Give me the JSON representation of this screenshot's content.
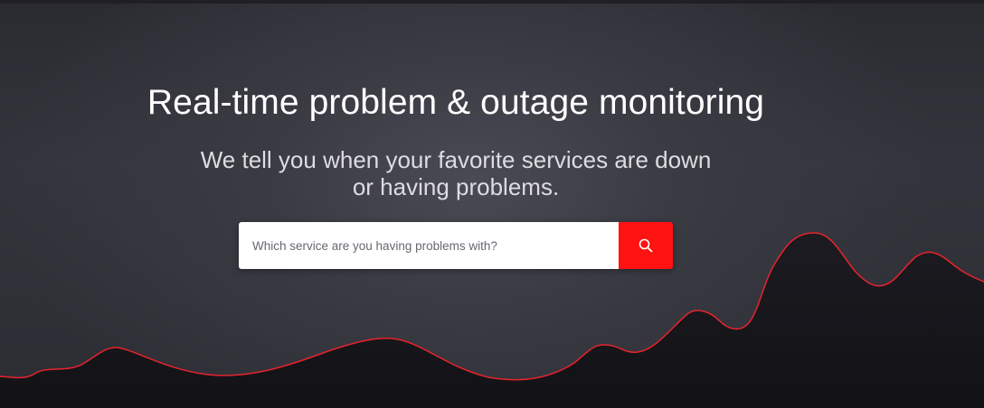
{
  "hero": {
    "title": "Real-time problem & outage monitoring",
    "subtitle_line1": "We tell you when your favorite services are down",
    "subtitle_line2": "or having problems."
  },
  "search": {
    "placeholder": "Which service are you having problems with?",
    "button_icon": "search-icon"
  },
  "colors": {
    "accent": "#ff1212",
    "graph_line": "#e8232b",
    "graph_fill": "#17171c",
    "background": "#34343c"
  }
}
